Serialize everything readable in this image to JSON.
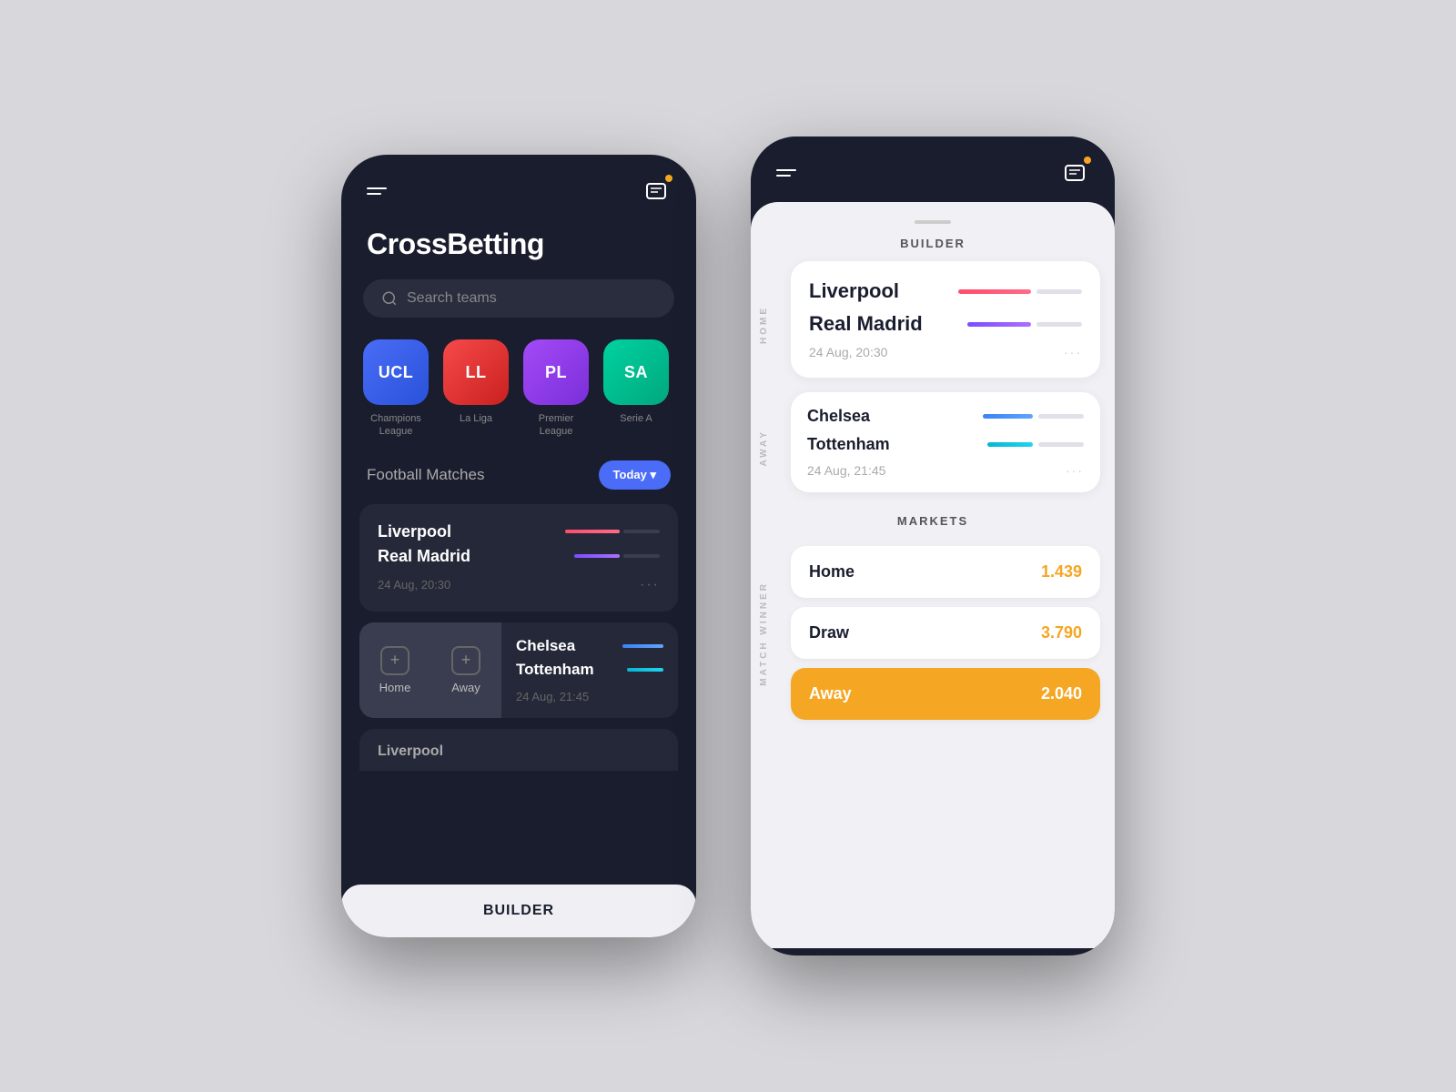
{
  "app": {
    "name": "CrossBetting",
    "builder_label": "BUILDER"
  },
  "left_phone": {
    "search": {
      "placeholder": "Search teams"
    },
    "leagues": [
      {
        "code": "UCL",
        "name": "Champions\nLeague",
        "class": "badge-ucl"
      },
      {
        "code": "LL",
        "name": "La Liga",
        "class": "badge-ll"
      },
      {
        "code": "PL",
        "name": "Premier\nLeague",
        "class": "badge-pl"
      },
      {
        "code": "SA",
        "name": "Serie A",
        "class": "badge-sa"
      }
    ],
    "football_matches": "Football Matches",
    "today_btn": "Today ▾",
    "matches": [
      {
        "team1": "Liverpool",
        "team2": "Real Madrid",
        "date": "24 Aug, 20:30"
      },
      {
        "team1": "Chelsea",
        "team2": "Tottenham",
        "date": "24 Aug, 21:45"
      },
      {
        "team1": "Liverpool",
        "team2": "",
        "date": ""
      }
    ],
    "swipe_actions": {
      "home": "Home",
      "away": "Away"
    }
  },
  "right_phone": {
    "builder_title": "BUILDER",
    "home_label": "HOME",
    "away_label": "AWAY",
    "match_winner_label": "MATCH WINNER",
    "matches": [
      {
        "team1": "Liverpool",
        "team2": "Real Madrid",
        "date": "24 Aug, 20:30"
      },
      {
        "team1": "Chelsea",
        "team2": "Tottenham",
        "date": "24 Aug, 21:45"
      }
    ],
    "markets_title": "MARKETS",
    "markets": [
      {
        "label": "Home",
        "odds": "1.439",
        "highlighted": false
      },
      {
        "label": "Draw",
        "odds": "3.790",
        "highlighted": false
      },
      {
        "label": "Away",
        "odds": "2.040",
        "highlighted": true
      }
    ]
  }
}
